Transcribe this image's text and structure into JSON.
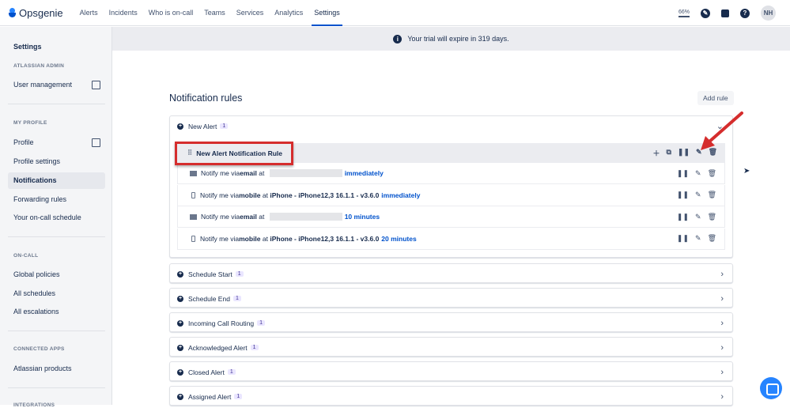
{
  "nav": {
    "brand": "Opsgenie",
    "items": [
      "Alerts",
      "Incidents",
      "Who is on-call",
      "Teams",
      "Services",
      "Analytics",
      "Settings"
    ],
    "active": "Settings",
    "usage": "66%",
    "avatar": "NH"
  },
  "sidebar": {
    "title": "Settings",
    "sections": [
      {
        "header": "ATLASSIAN ADMIN",
        "items": [
          "User management"
        ]
      },
      {
        "header": "MY PROFILE",
        "items": [
          "Profile",
          "Profile settings",
          "Notifications",
          "Forwarding rules",
          "Your on-call schedule"
        ]
      },
      {
        "header": "ON-CALL",
        "items": [
          "Global policies",
          "All schedules",
          "All escalations"
        ]
      },
      {
        "header": "CONNECTED APPS",
        "items": [
          "Atlassian products"
        ]
      },
      {
        "header": "INTEGRATIONS",
        "items": []
      }
    ],
    "selected": "Notifications"
  },
  "banner": "Your trial will expire in 319 days.",
  "main": {
    "title": "Notification rules",
    "add_rule": "Add rule",
    "expanded": {
      "name": "New Alert",
      "count": "1",
      "rule": "New Alert Notification Rule",
      "steps": [
        {
          "icon": "email-icon",
          "pre": "Notify me via ",
          "method": "email",
          "mid": " at ",
          "target": "",
          "when": "immediately"
        },
        {
          "icon": "mobile-icon",
          "pre": "Notify me via ",
          "method": "mobile",
          "mid": " at ",
          "target": "iPhone - iPhone12,3 16.1.1 - v3.6.0",
          "when": "immediately"
        },
        {
          "icon": "email-icon",
          "pre": "Notify me via ",
          "method": "email",
          "mid": " at ",
          "target": "",
          "when": "10 minutes"
        },
        {
          "icon": "mobile-icon",
          "pre": "Notify me via ",
          "method": "mobile",
          "mid": " at ",
          "target": "iPhone - iPhone12,3 16.1.1 - v3.6.0",
          "when": "20 minutes"
        }
      ]
    },
    "collapsed": [
      {
        "name": "Schedule Start",
        "count": "1"
      },
      {
        "name": "Schedule End",
        "count": "1"
      },
      {
        "name": "Incoming Call Routing",
        "count": "1"
      },
      {
        "name": "Acknowledged Alert",
        "count": "1"
      },
      {
        "name": "Closed Alert",
        "count": "1"
      },
      {
        "name": "Assigned Alert",
        "count": "1"
      }
    ]
  },
  "colors": {
    "accent": "#0052cc",
    "highlight": "#d52d2d"
  }
}
